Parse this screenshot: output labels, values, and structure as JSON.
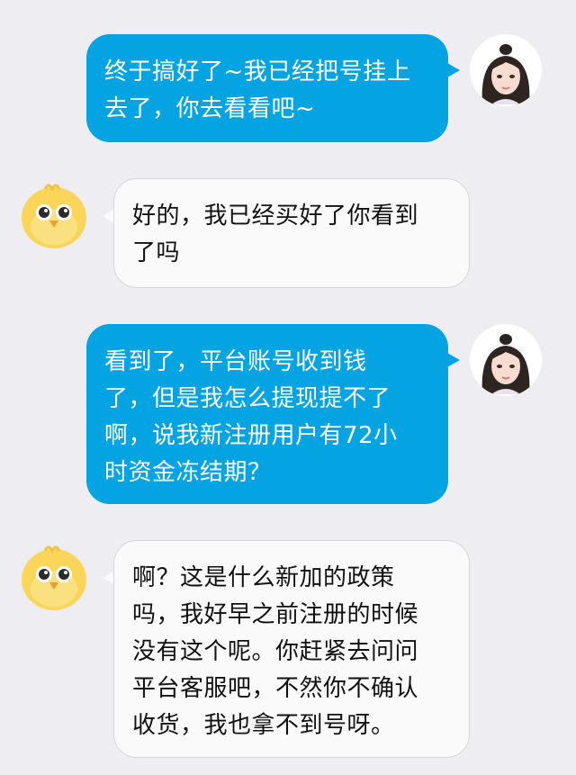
{
  "messages": [
    {
      "sender": "self",
      "avatar": "girl-avatar-icon",
      "lines": [
        "终于搞好了~我已经把号挂上",
        "去了，你去看看吧~"
      ]
    },
    {
      "sender": "other",
      "avatar": "chick-avatar-icon",
      "lines": [
        "好的，我已经买好了你看到",
        "了吗"
      ]
    },
    {
      "sender": "self",
      "avatar": "girl-avatar-icon",
      "lines": [
        "看到了，平台账号收到钱",
        "了，但是我怎么提现提不了",
        "啊，说我新注册用户有72小",
        "时资金冻结期？"
      ]
    },
    {
      "sender": "other",
      "avatar": "chick-avatar-icon",
      "lines": [
        "啊？这是什么新加的政策",
        "吗，我好早之前注册的时候",
        "没有这个呢。你赶紧去问问",
        "平台客服吧，不然你不确认",
        "收货，我也拿不到号呀。"
      ]
    }
  ],
  "colors": {
    "background": "#ededf2",
    "outgoing_bubble": "#04a3e1",
    "incoming_bubble": "#fafafa"
  }
}
